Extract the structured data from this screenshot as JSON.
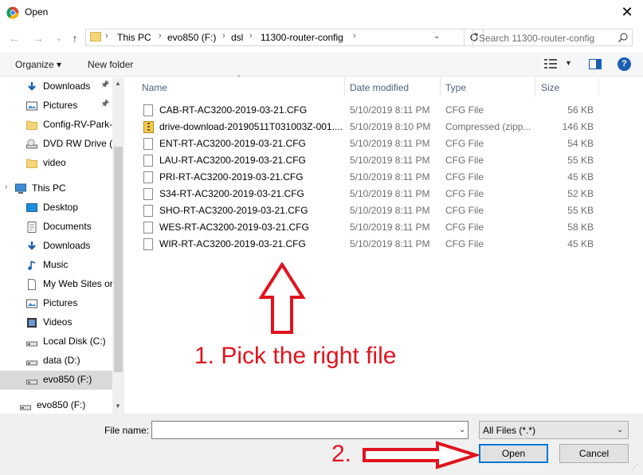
{
  "window": {
    "title": "Open",
    "close_glyph": "✕"
  },
  "nav": {
    "back_glyph": "←",
    "forward_glyph": "→",
    "recent_glyph": "⌄",
    "up_glyph": "↑",
    "breadcrumbs": [
      "This PC",
      "evo850 (F:)",
      "dsl",
      "11300-router-config"
    ],
    "search_placeholder": "Search 11300-router-config"
  },
  "toolbar": {
    "organize_label": "Organize ▾",
    "new_folder_label": "New folder",
    "help_glyph": "?"
  },
  "sidebar": {
    "items": [
      {
        "label": "Downloads",
        "icon": "download-arrow-icon",
        "pinned": true
      },
      {
        "label": "Pictures",
        "icon": "pictures-icon",
        "pinned": true
      },
      {
        "label": "Config-RV-Park-",
        "icon": "folder-icon",
        "pinned": false
      },
      {
        "label": "DVD RW Drive (E",
        "icon": "dvd-drive-icon",
        "pinned": false
      },
      {
        "label": "video",
        "icon": "folder-icon",
        "pinned": false
      },
      {
        "label": "This PC",
        "icon": "computer-icon",
        "pinned": false
      },
      {
        "label": "Desktop",
        "icon": "desktop-icon",
        "pinned": false
      },
      {
        "label": "Documents",
        "icon": "documents-icon",
        "pinned": false
      },
      {
        "label": "Downloads",
        "icon": "download-arrow-icon",
        "pinned": false
      },
      {
        "label": "Music",
        "icon": "music-icon",
        "pinned": false
      },
      {
        "label": "My Web Sites or",
        "icon": "file-icon",
        "pinned": false
      },
      {
        "label": "Pictures",
        "icon": "pictures-icon",
        "pinned": false
      },
      {
        "label": "Videos",
        "icon": "videos-icon",
        "pinned": false
      },
      {
        "label": "Local Disk (C:)",
        "icon": "drive-icon",
        "pinned": false
      },
      {
        "label": "data (D:)",
        "icon": "drive-icon",
        "pinned": false
      },
      {
        "label": "evo850 (F:)",
        "icon": "drive-icon",
        "pinned": false,
        "selected": true
      },
      {
        "label": "evo850 (F:)",
        "icon": "drive-icon",
        "pinned": false
      }
    ]
  },
  "columns": {
    "name": "Name",
    "date": "Date modified",
    "type": "Type",
    "size": "Size"
  },
  "files": [
    {
      "name": "CAB-RT-AC3200-2019-03-21.CFG",
      "date": "5/10/2019 8:11 PM",
      "type": "CFG File",
      "size": "56 KB",
      "kind": "file"
    },
    {
      "name": "drive-download-20190511T031003Z-001....",
      "date": "5/10/2019 8:10 PM",
      "type": "Compressed (zipp...",
      "size": "146 KB",
      "kind": "zip"
    },
    {
      "name": "ENT-RT-AC3200-2019-03-21.CFG",
      "date": "5/10/2019 8:11 PM",
      "type": "CFG File",
      "size": "54 KB",
      "kind": "file"
    },
    {
      "name": "LAU-RT-AC3200-2019-03-21.CFG",
      "date": "5/10/2019 8:11 PM",
      "type": "CFG File",
      "size": "55 KB",
      "kind": "file"
    },
    {
      "name": "PRI-RT-AC3200-2019-03-21.CFG",
      "date": "5/10/2019 8:11 PM",
      "type": "CFG File",
      "size": "45 KB",
      "kind": "file"
    },
    {
      "name": "S34-RT-AC3200-2019-03-21.CFG",
      "date": "5/10/2019 8:11 PM",
      "type": "CFG File",
      "size": "52 KB",
      "kind": "file"
    },
    {
      "name": "SHO-RT-AC3200-2019-03-21.CFG",
      "date": "5/10/2019 8:11 PM",
      "type": "CFG File",
      "size": "55 KB",
      "kind": "file"
    },
    {
      "name": "WES-RT-AC3200-2019-03-21.CFG",
      "date": "5/10/2019 8:11 PM",
      "type": "CFG File",
      "size": "58 KB",
      "kind": "file"
    },
    {
      "name": "WIR-RT-AC3200-2019-03-21.CFG",
      "date": "5/10/2019 8:11 PM",
      "type": "CFG File",
      "size": "45 KB",
      "kind": "file"
    }
  ],
  "annotations": {
    "step1": "1. Pick the right file",
    "step2": "2.",
    "color": "#e0141e"
  },
  "footer": {
    "filename_label": "File name:",
    "filename_value": "",
    "filter_value": "All Files (*.*)",
    "open_label": "Open",
    "cancel_label": "Cancel"
  }
}
